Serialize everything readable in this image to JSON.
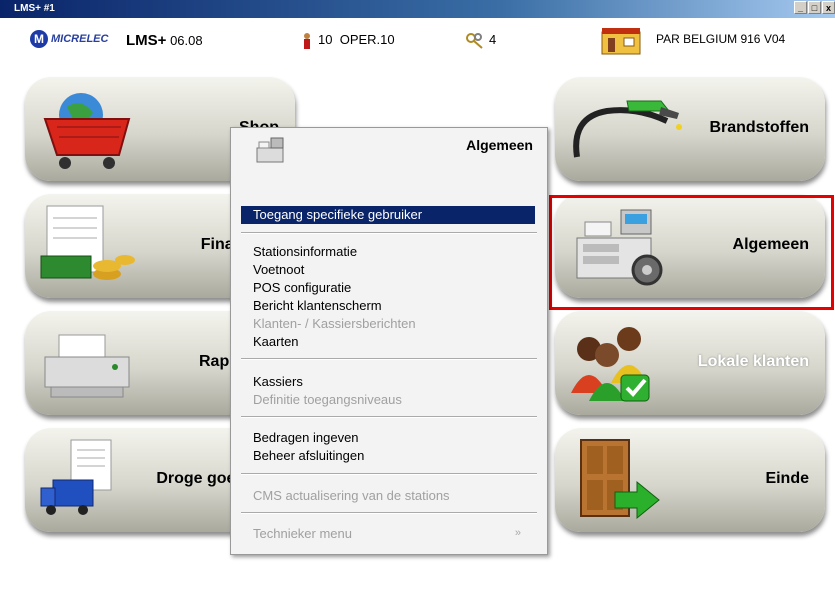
{
  "window": {
    "title": "LMS+ #1",
    "controls": [
      "_",
      "ᴈ",
      "x"
    ]
  },
  "header": {
    "logo_text": "MICRELEC",
    "app_name": "LMS+",
    "version": "06.08",
    "operator_id": "10",
    "operator_name": "OPER.10",
    "key_count": "4",
    "station": "PAR BELGIUM 916 V04"
  },
  "tiles": {
    "shop": "Shop",
    "finance": "Financieel",
    "reports": "Rapporten",
    "dry_goods": "Droge goederen",
    "fuels": "Brandstoffen",
    "general": "Algemeen",
    "local_customers": "Lokale klanten",
    "end": "Einde"
  },
  "menu": {
    "title": "Algemeen",
    "selected": "Toegang specifieke gebruiker",
    "items": [
      "Stationsinformatie",
      "Voetnoot",
      "POS configuratie",
      "Bericht klantenscherm",
      "Klanten- / Kassiersberichten",
      "Kaarten",
      "Kassiers",
      "Definitie toegangsniveaus",
      "Bedragen ingeven",
      "Beheer afsluitingen",
      "CMS actualisering van de stations",
      "Technieker menu"
    ],
    "submenu_arrow": "»"
  }
}
